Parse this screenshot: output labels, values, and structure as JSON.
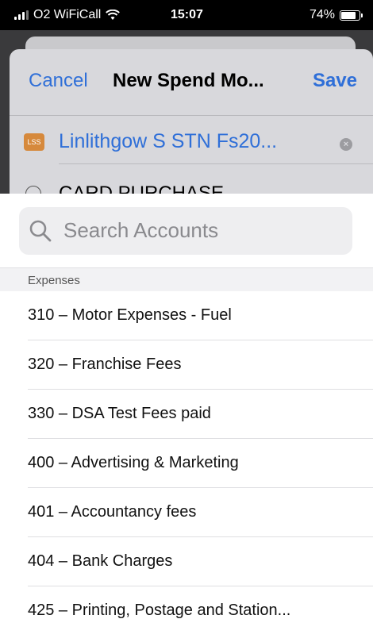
{
  "status_bar": {
    "carrier": "O2 WiFiCall",
    "time": "15:07",
    "battery": "74%",
    "battery_level": 0.74
  },
  "sheet": {
    "cancel_label": "Cancel",
    "title": "New Spend Mo...",
    "save_label": "Save",
    "contact_badge": "LSS",
    "contact_name": "Linlithgow S STN Fs20...",
    "description": "CARD PURCHASE"
  },
  "picker": {
    "search_placeholder": "Search Accounts",
    "section_header": "Expenses",
    "accounts": [
      "310 – Motor Expenses - Fuel",
      "320 – Franchise Fees",
      "330 – DSA Test Fees paid",
      "400 – Advertising & Marketing",
      "401 – Accountancy fees",
      "404 – Bank Charges",
      "425 – Printing, Postage and Station..."
    ]
  },
  "colors": {
    "accent": "#2f6fd8",
    "badge": "#d6893c"
  }
}
